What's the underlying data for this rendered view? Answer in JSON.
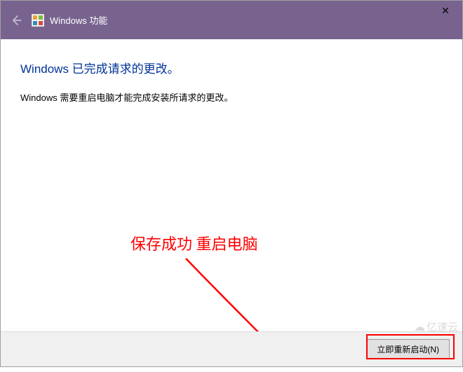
{
  "titlebar": {
    "title": "Windows 功能",
    "close": "✕"
  },
  "content": {
    "heading": "Windows 已完成请求的更改。",
    "body": "Windows 需要重启电脑才能完成安装所请求的更改。"
  },
  "footer": {
    "restart_label": "立即重新启动(N)"
  },
  "annotation": {
    "text": "保存成功 重启电脑"
  },
  "watermark": {
    "text": "亿速云"
  }
}
